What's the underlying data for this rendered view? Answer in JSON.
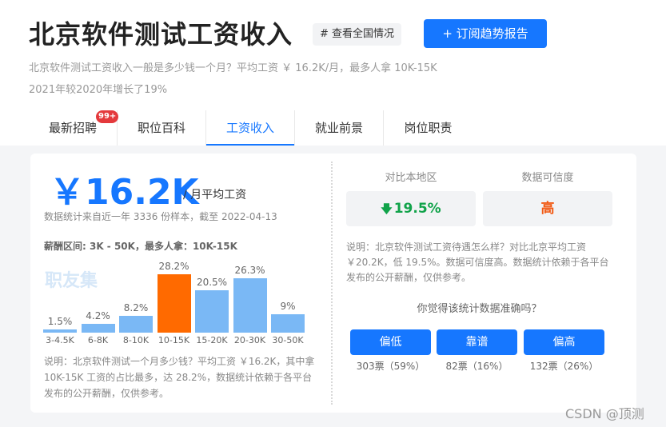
{
  "header": {
    "title": "北京软件测试工资收入",
    "national_tag": "# 查看全国情况",
    "subscribe_button": "+ 订阅趋势报告",
    "description_line1": "北京软件测试工资收入一般是多少钱一个月？平均工资 ￥ 16.2K/月，最多人拿 10K-15K",
    "description_line2": "2021年较2020年增长了19%"
  },
  "tabs": [
    {
      "label": "最新招聘",
      "badge": "99+"
    },
    {
      "label": "职位百科"
    },
    {
      "label": "工资收入",
      "active": true
    },
    {
      "label": "就业前景"
    },
    {
      "label": "岗位职责"
    }
  ],
  "salary": {
    "amount": "￥16.2K",
    "unit": "/ 月平均工资",
    "source": "数据统计来自近一年 3336 份样本，截至 2022-04-13",
    "range_line": "薪酬区间: 3K - 50K，最多人拿：10K-15K",
    "watermark": "职友集",
    "note": "说明：北京软件测试一个月多少钱？平均工资 ￥16.2K，其中拿 10K-15K 工资的占比最多，达 28.2%，数据统计依赖于各平台发布的公开薪酬，仅供参考。"
  },
  "chart_data": {
    "type": "bar",
    "categories": [
      "3-4.5K",
      "6-8K",
      "8-10K",
      "10-15K",
      "15-20K",
      "20-30K",
      "30-50K"
    ],
    "values": [
      1.5,
      4.2,
      8.2,
      28.2,
      20.5,
      26.3,
      9
    ],
    "value_labels": [
      "1.5%",
      "4.2%",
      "8.2%",
      "28.2%",
      "20.5%",
      "26.3%",
      "9%"
    ],
    "highlight_index": 3,
    "ylim": [
      0,
      28.2
    ],
    "colors": {
      "normal": "#7ab8f5",
      "highlight": "#ff6a00"
    }
  },
  "comparison": {
    "local_label": "对比本地区",
    "local_value": "19.5%",
    "local_arrow": "down-arrow-icon",
    "credibility_label": "数据可信度",
    "credibility_value": "高",
    "note": "说明：北京软件测试工资待遇怎么样？对比北京平均工资 ￥20.2K，低 19.5%。数据可信度高。数据统计依赖于各平台发布的公开薪酬，仅供参考。"
  },
  "feedback": {
    "question": "你觉得该统计数据准确吗？",
    "options": [
      {
        "label": "偏低",
        "count": "303票（59%）"
      },
      {
        "label": "靠谱",
        "count": "82票（16%）"
      },
      {
        "label": "偏高",
        "count": "132票（26%）"
      }
    ]
  },
  "footer": {
    "watermark": "CSDN @顶测"
  },
  "colors": {
    "accent": "#1677ff",
    "badge": "#e4393c",
    "green": "#11a34a",
    "orange": "#f25a14"
  }
}
